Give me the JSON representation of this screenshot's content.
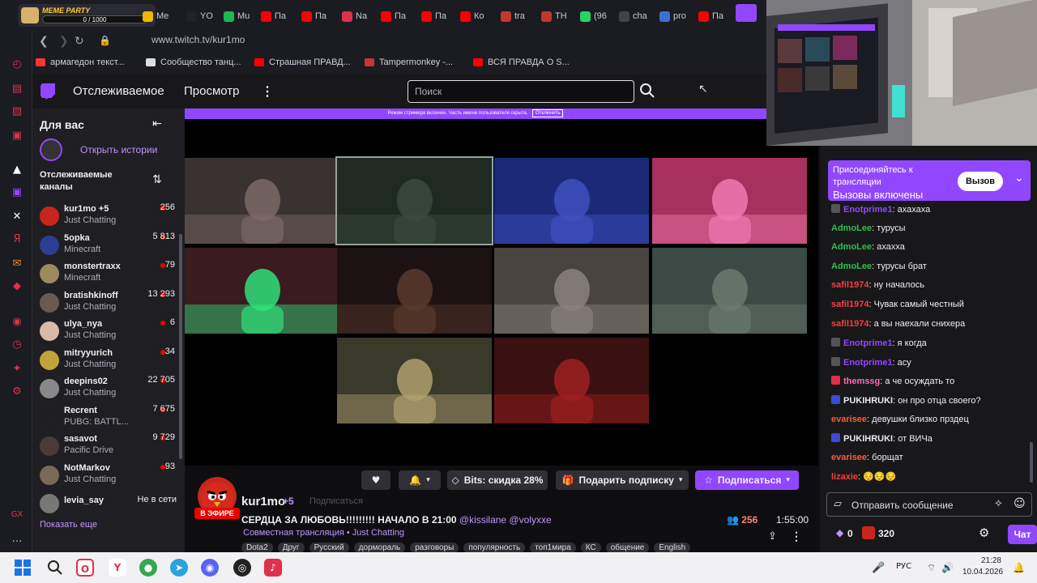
{
  "browser": {
    "url": "www.twitch.tv/kur1mo",
    "meme_party": {
      "title": "MEME PARTY",
      "progress": "0 / 1000"
    },
    "tabs": [
      {
        "label": "Me",
        "color": "#f2b600"
      },
      {
        "label": "YO",
        "color": "#222222"
      },
      {
        "label": "Mu",
        "color": "#1db954"
      },
      {
        "label": "Па",
        "color": "#ff0000"
      },
      {
        "label": "Па",
        "color": "#ff0000"
      },
      {
        "label": "Na",
        "color": "#e0304a"
      },
      {
        "label": "Па",
        "color": "#ff0000"
      },
      {
        "label": "Па",
        "color": "#ff0000"
      },
      {
        "label": "Ко",
        "color": "#ff0000"
      },
      {
        "label": "tra",
        "color": "#c0392b"
      },
      {
        "label": "ТН",
        "color": "#c0392b"
      },
      {
        "label": "(96",
        "color": "#25d366"
      },
      {
        "label": "cha",
        "color": "#444444"
      },
      {
        "label": "pro",
        "color": "#3b6fd4"
      },
      {
        "label": "Па",
        "color": "#ff0000"
      }
    ],
    "bookmarks": [
      {
        "label": "армагедон текст...",
        "color": "#ff3333"
      },
      {
        "label": "Сообщество танц...",
        "color": "#dddddd"
      },
      {
        "label": "Страшная ПРАВД...",
        "color": "#ff0000"
      },
      {
        "label": "Tampermonkey -...",
        "color": "#cc3333"
      },
      {
        "label": "ВСЯ ПРАВДА О S...",
        "color": "#ff0000"
      }
    ]
  },
  "topnav": {
    "following": "Отслеживаемое",
    "browse": "Просмотр",
    "search_placeholder": "Поиск"
  },
  "streamer_mode_banner": {
    "text": "Режим стримера включен. Часть имени пользователя скрыта.",
    "button": "Отключить"
  },
  "sidenav": {
    "for_you": "Для вас",
    "stories": "Открыть истории",
    "followed": "Отслеживаемые каналы",
    "show_more": "Показать еще",
    "channels": [
      {
        "name": "kur1mo +5",
        "game": "Just Chatting",
        "viewers": "256",
        "live": true,
        "color": "#c8261c"
      },
      {
        "name": "5opka",
        "game": "Minecraft",
        "viewers": "5 813",
        "live": true,
        "color": "#2c3e8f"
      },
      {
        "name": "monstertraxx",
        "game": "Minecraft",
        "viewers": "79",
        "live": true,
        "color": "#9a8a5c"
      },
      {
        "name": "bratishkinoff",
        "game": "Just Chatting",
        "viewers": "13 293",
        "live": true,
        "color": "#6b5a52"
      },
      {
        "name": "ulya_nya",
        "game": "Just Chatting",
        "viewers": "6",
        "live": true,
        "color": "#d9b9a8"
      },
      {
        "name": "mitryyurich",
        "game": "Just Chatting",
        "viewers": "34",
        "live": true,
        "color": "#c2a33a"
      },
      {
        "name": "deepins02",
        "game": "Just Chatting",
        "viewers": "22 705",
        "live": true,
        "color": "#888888"
      },
      {
        "name": "Recrent",
        "game": "PUBG: BATTL...",
        "viewers": "7 675",
        "live": true,
        "color": "#1f1f1f"
      },
      {
        "name": "sasavot",
        "game": "Pacific Drive",
        "viewers": "9 729",
        "live": true,
        "color": "#4a3a3a"
      },
      {
        "name": "NotMarkov",
        "game": "Just Chatting",
        "viewers": "93",
        "live": true,
        "color": "#7a6a5a"
      },
      {
        "name": "levia_say",
        "game": "",
        "viewers": "Не в сети",
        "live": false,
        "color": "#777777"
      }
    ]
  },
  "stream": {
    "streamer": "kur1mo",
    "collab_count": "+5",
    "live_badge": "В ЭФИРЕ",
    "following_status": "Подписаться",
    "title": "СЕРДЦА ЗА ЛЮБОВЬ!!!!!!!!! НАЧАЛО В 21:00",
    "mentions": "@kissilane @volyxxe",
    "category": "Совместная трансляция • Just Chatting",
    "viewers": "256",
    "uptime": "1:55:00",
    "tags": [
      "Dota2",
      "Друг",
      "Русский",
      "дормораль",
      "разговоры",
      "популярность",
      "топ1мира",
      "КС",
      "общение",
      "English"
    ],
    "bits_label": "Bits: скидка 28%",
    "gift_label": "Подарить подписку",
    "subscribe_label": "Подписаться"
  },
  "video_grid": [
    {
      "bg": "#3a3230",
      "accent": "#7a6a66"
    },
    {
      "bg": "#1f2a22",
      "accent": "#3a4a3c"
    },
    {
      "bg": "#1a2a78",
      "accent": "#4050c0"
    },
    {
      "bg": "#a8305e",
      "accent": "#f07ab0"
    },
    {
      "bg": "#3a1c20",
      "accent": "#30e07a"
    },
    {
      "bg": "#1c1214",
      "accent": "#5a3a2a"
    },
    {
      "bg": "#4a4440",
      "accent": "#8a827a"
    },
    {
      "bg": "#3a4a44",
      "accent": "#6a7a70"
    },
    {
      "bg": "#3a3a2a",
      "accent": "#b0a070"
    },
    {
      "bg": "#3a1010",
      "accent": "#a02020"
    }
  ],
  "chat": {
    "collab_title": "Присоединяйтесь к трансляции",
    "collab_status": "Вызовы включены",
    "collab_button": "Вызов",
    "messages": [
      {
        "user": "Enotprime1",
        "text": "ахахаха",
        "color": "#9147ff",
        "badge": "#555555"
      },
      {
        "user": "AdmoLee",
        "text": "турусы",
        "color": "#2fbf4f",
        "badge": ""
      },
      {
        "user": "AdmoLee",
        "text": "ахахха",
        "color": "#2fbf4f",
        "badge": ""
      },
      {
        "user": "AdmoLee",
        "text": "турусы брат",
        "color": "#2fbf4f",
        "badge": ""
      },
      {
        "user": "safil1974",
        "text": "ну началось",
        "color": "#ff3c3c",
        "badge": ""
      },
      {
        "user": "safil1974",
        "text": "Чувак самый честный",
        "color": "#ff3c3c",
        "badge": ""
      },
      {
        "user": "safil1974",
        "text": "а вы наехали снихера",
        "color": "#ff3c3c",
        "badge": ""
      },
      {
        "user": "Enotprime1",
        "text": "я когда",
        "color": "#9147ff",
        "badge": "#555555"
      },
      {
        "user": "Enotprime1",
        "text": "асу",
        "color": "#9147ff",
        "badge": "#555555"
      },
      {
        "user": "themssg",
        "text": "а че осуждать то",
        "color": "#ff69b4",
        "badge": "#e0304a"
      },
      {
        "user": "PUKIHRUKI",
        "text": "он про отца своего?",
        "color": "#e8e8f0",
        "badge": "#3b4bd4"
      },
      {
        "user": "evarisee",
        "text": "девушки близко прздец",
        "color": "#ff5a3c",
        "badge": ""
      },
      {
        "user": "PUKIHRUKI",
        "text": "от ВИЧа",
        "color": "#e8e8f0",
        "badge": "#3b4bd4"
      },
      {
        "user": "evarisee",
        "text": "борщат",
        "color": "#ff5a3c",
        "badge": ""
      },
      {
        "user": "lizaxie",
        "text": "😔😔😔",
        "color": "#ff3c3c",
        "badge": ""
      }
    ],
    "input_placeholder": "Отправить сообщение",
    "points_a": "0",
    "points_b": "320",
    "chat_button": "Чат"
  },
  "taskbar": {
    "language": "РУС",
    "time": "21:28",
    "date": "10.04.2026"
  }
}
